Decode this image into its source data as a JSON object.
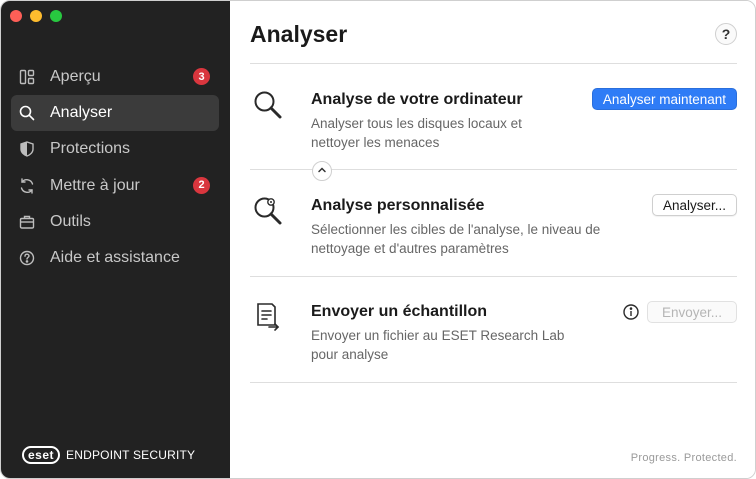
{
  "colors": {
    "sidebar_bg": "#222222",
    "accent": "#2f7cf6",
    "badge": "#d9363e",
    "traffic_red": "#fe5f57",
    "traffic_yellow": "#febc2e",
    "traffic_green": "#28c840"
  },
  "sidebar": {
    "items": [
      {
        "label": "Aperçu",
        "icon": "overview-icon",
        "badge": "3"
      },
      {
        "label": "Analyser",
        "icon": "search-icon",
        "active": true
      },
      {
        "label": "Protections",
        "icon": "shield-icon"
      },
      {
        "label": "Mettre à jour",
        "icon": "refresh-icon",
        "badge": "2"
      },
      {
        "label": "Outils",
        "icon": "briefcase-icon"
      },
      {
        "label": "Aide et assistance",
        "icon": "help-circle-icon"
      }
    ],
    "brand_logo": "eset",
    "brand_name": "ENDPOINT SECURITY"
  },
  "main": {
    "title": "Analyser",
    "help_label": "?",
    "rows": [
      {
        "title": "Analyse de votre ordinateur",
        "description": "Analyser tous les disques locaux et nettoyer les menaces",
        "button": "Analyser maintenant",
        "icon": "magnifier-icon"
      },
      {
        "title": "Analyse personnalisée",
        "description": "Sélectionner les cibles de l'analyse, le niveau de nettoyage et d'autres paramètres",
        "button": "Analyser...",
        "icon": "magnifier-gear-icon"
      },
      {
        "title": "Envoyer un échantillon",
        "description": "Envoyer un fichier au ESET Research Lab pour analyse",
        "button": "Envoyer...",
        "icon": "document-send-icon"
      }
    ],
    "footer_tagline": "Progress. Protected."
  }
}
